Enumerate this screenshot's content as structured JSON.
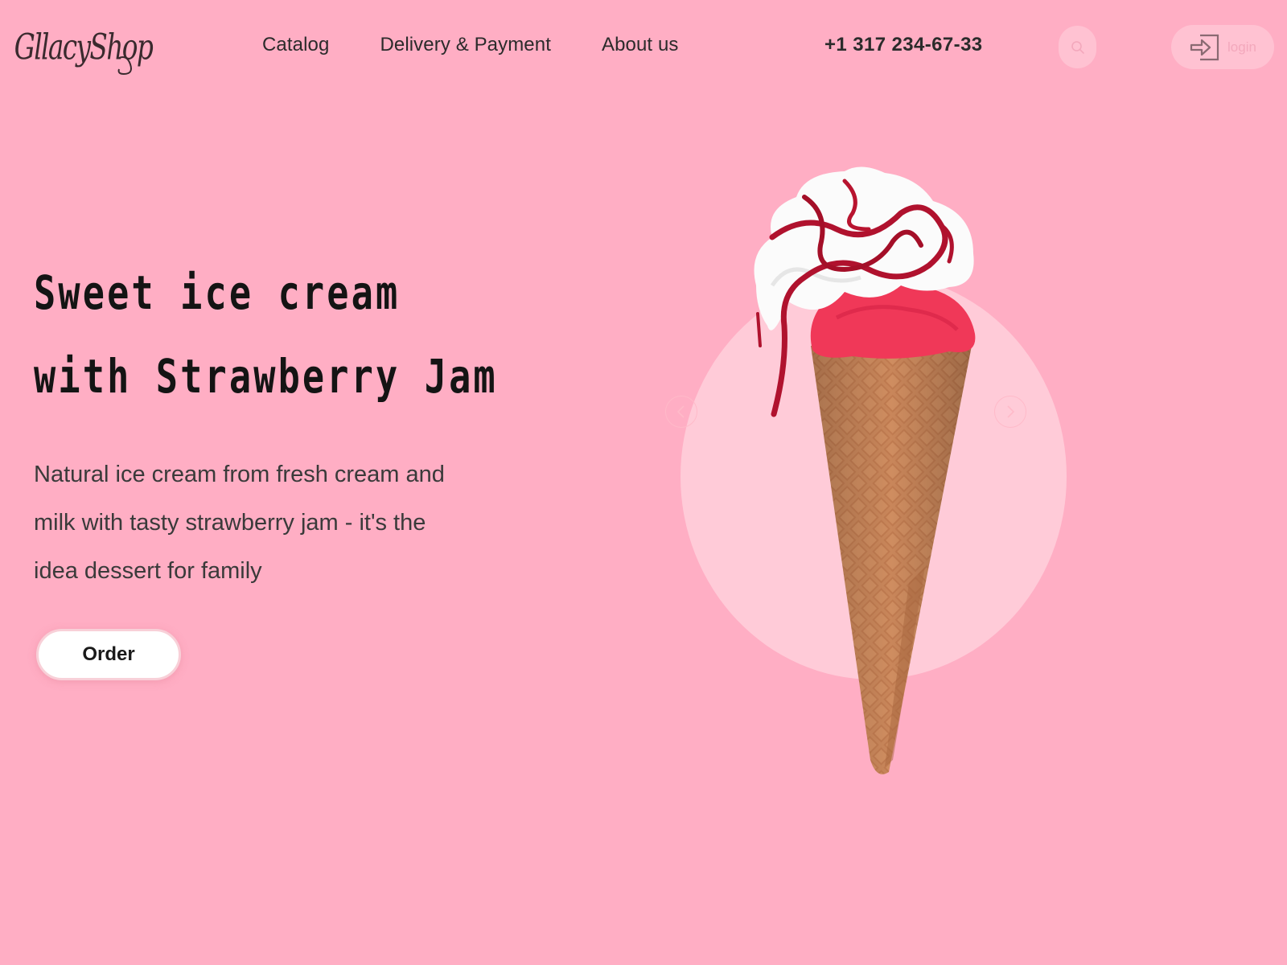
{
  "brand": {
    "logo_text": "GllacyShop"
  },
  "nav": {
    "items": [
      {
        "label": "Catalog"
      },
      {
        "label": "Delivery & Payment"
      },
      {
        "label": "About us"
      }
    ]
  },
  "header": {
    "phone": "+1 317 234-67-33",
    "search_icon": "search-icon",
    "login_label": "login",
    "login_icon": "login-arrow-icon"
  },
  "hero": {
    "title_line1": "Sweet ice cream",
    "title_line2": "with Strawberry Jam",
    "desc_line1": "Natural ice cream from fresh cream and",
    "desc_line2": "milk with tasty strawberry jam - it's the",
    "desc_line3": "idea dessert for family",
    "order_label": "Order"
  },
  "slider": {
    "prev_icon": "chevron-left-icon",
    "next_icon": "chevron-right-icon",
    "product_image": "ice-cream-cone-image"
  },
  "colors": {
    "background": "#ffaec4",
    "circle": "#ffcbd8",
    "button_soft": "#ffc2d2",
    "text_dark": "#141414"
  }
}
